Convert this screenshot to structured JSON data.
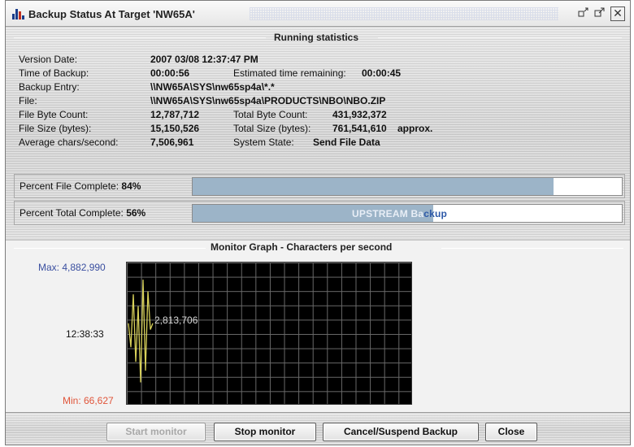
{
  "window": {
    "title": "Backup Status At Target 'NW65A'",
    "controls": [
      "restore-icon",
      "maximize-icon",
      "close-icon"
    ]
  },
  "running": {
    "section_title": "Running statistics",
    "version_date_label": "Version Date:",
    "version_date": "2007 03/08 12:37:47 PM",
    "time_label": "Time of Backup:",
    "time": "00:00:56",
    "remaining_label": "Estimated time remaining:",
    "remaining": "00:00:45",
    "entry_label": "Backup Entry:",
    "entry": "\\\\NW65A\\SYS\\nw65sp4a\\*.*",
    "file_label": "File:",
    "file": "\\\\NW65A\\SYS\\nw65sp4a\\PRODUCTS\\NBO\\NBO.ZIP",
    "file_byte_label": "File Byte Count:",
    "file_byte": "12,787,712",
    "total_byte_label": "Total Byte Count:",
    "total_byte": "431,932,372",
    "file_size_label": "File Size (bytes):",
    "file_size": "15,150,526",
    "total_size_label": "Total Size (bytes):",
    "total_size": "761,541,610",
    "approx": "approx.",
    "avg_label": "Average chars/second:",
    "avg": "7,506,961",
    "state_label": "System State:",
    "state": "Send File Data"
  },
  "progress": {
    "file_label": "Percent File Complete:",
    "file_pct": "84%",
    "file_value": 0.84,
    "total_label": "Percent Total Complete:",
    "total_pct": "56%",
    "total_value": 0.56,
    "total_bar_text_light": "UPSTREAM Ba",
    "total_bar_text_dark": "ckup",
    "fill_color": "#9cb4c8"
  },
  "monitor": {
    "title": "Monitor Graph - Characters per second",
    "max": "Max: 4,882,990",
    "time": "12:38:33",
    "current": "2,813,706",
    "min": "Min: 66,627",
    "max_color": "#3a4fa0",
    "min_color": "#e0553a",
    "line_color": "#d8d15a",
    "line_samples": [
      2813706,
      2000000,
      3800000,
      1500000,
      3400000,
      800000,
      4300000,
      1200000,
      3900000,
      2600000,
      2813706
    ]
  },
  "buttons": {
    "start": "Start monitor",
    "stop": "Stop monitor",
    "cancel": "Cancel/Suspend Backup",
    "close": "Close"
  }
}
